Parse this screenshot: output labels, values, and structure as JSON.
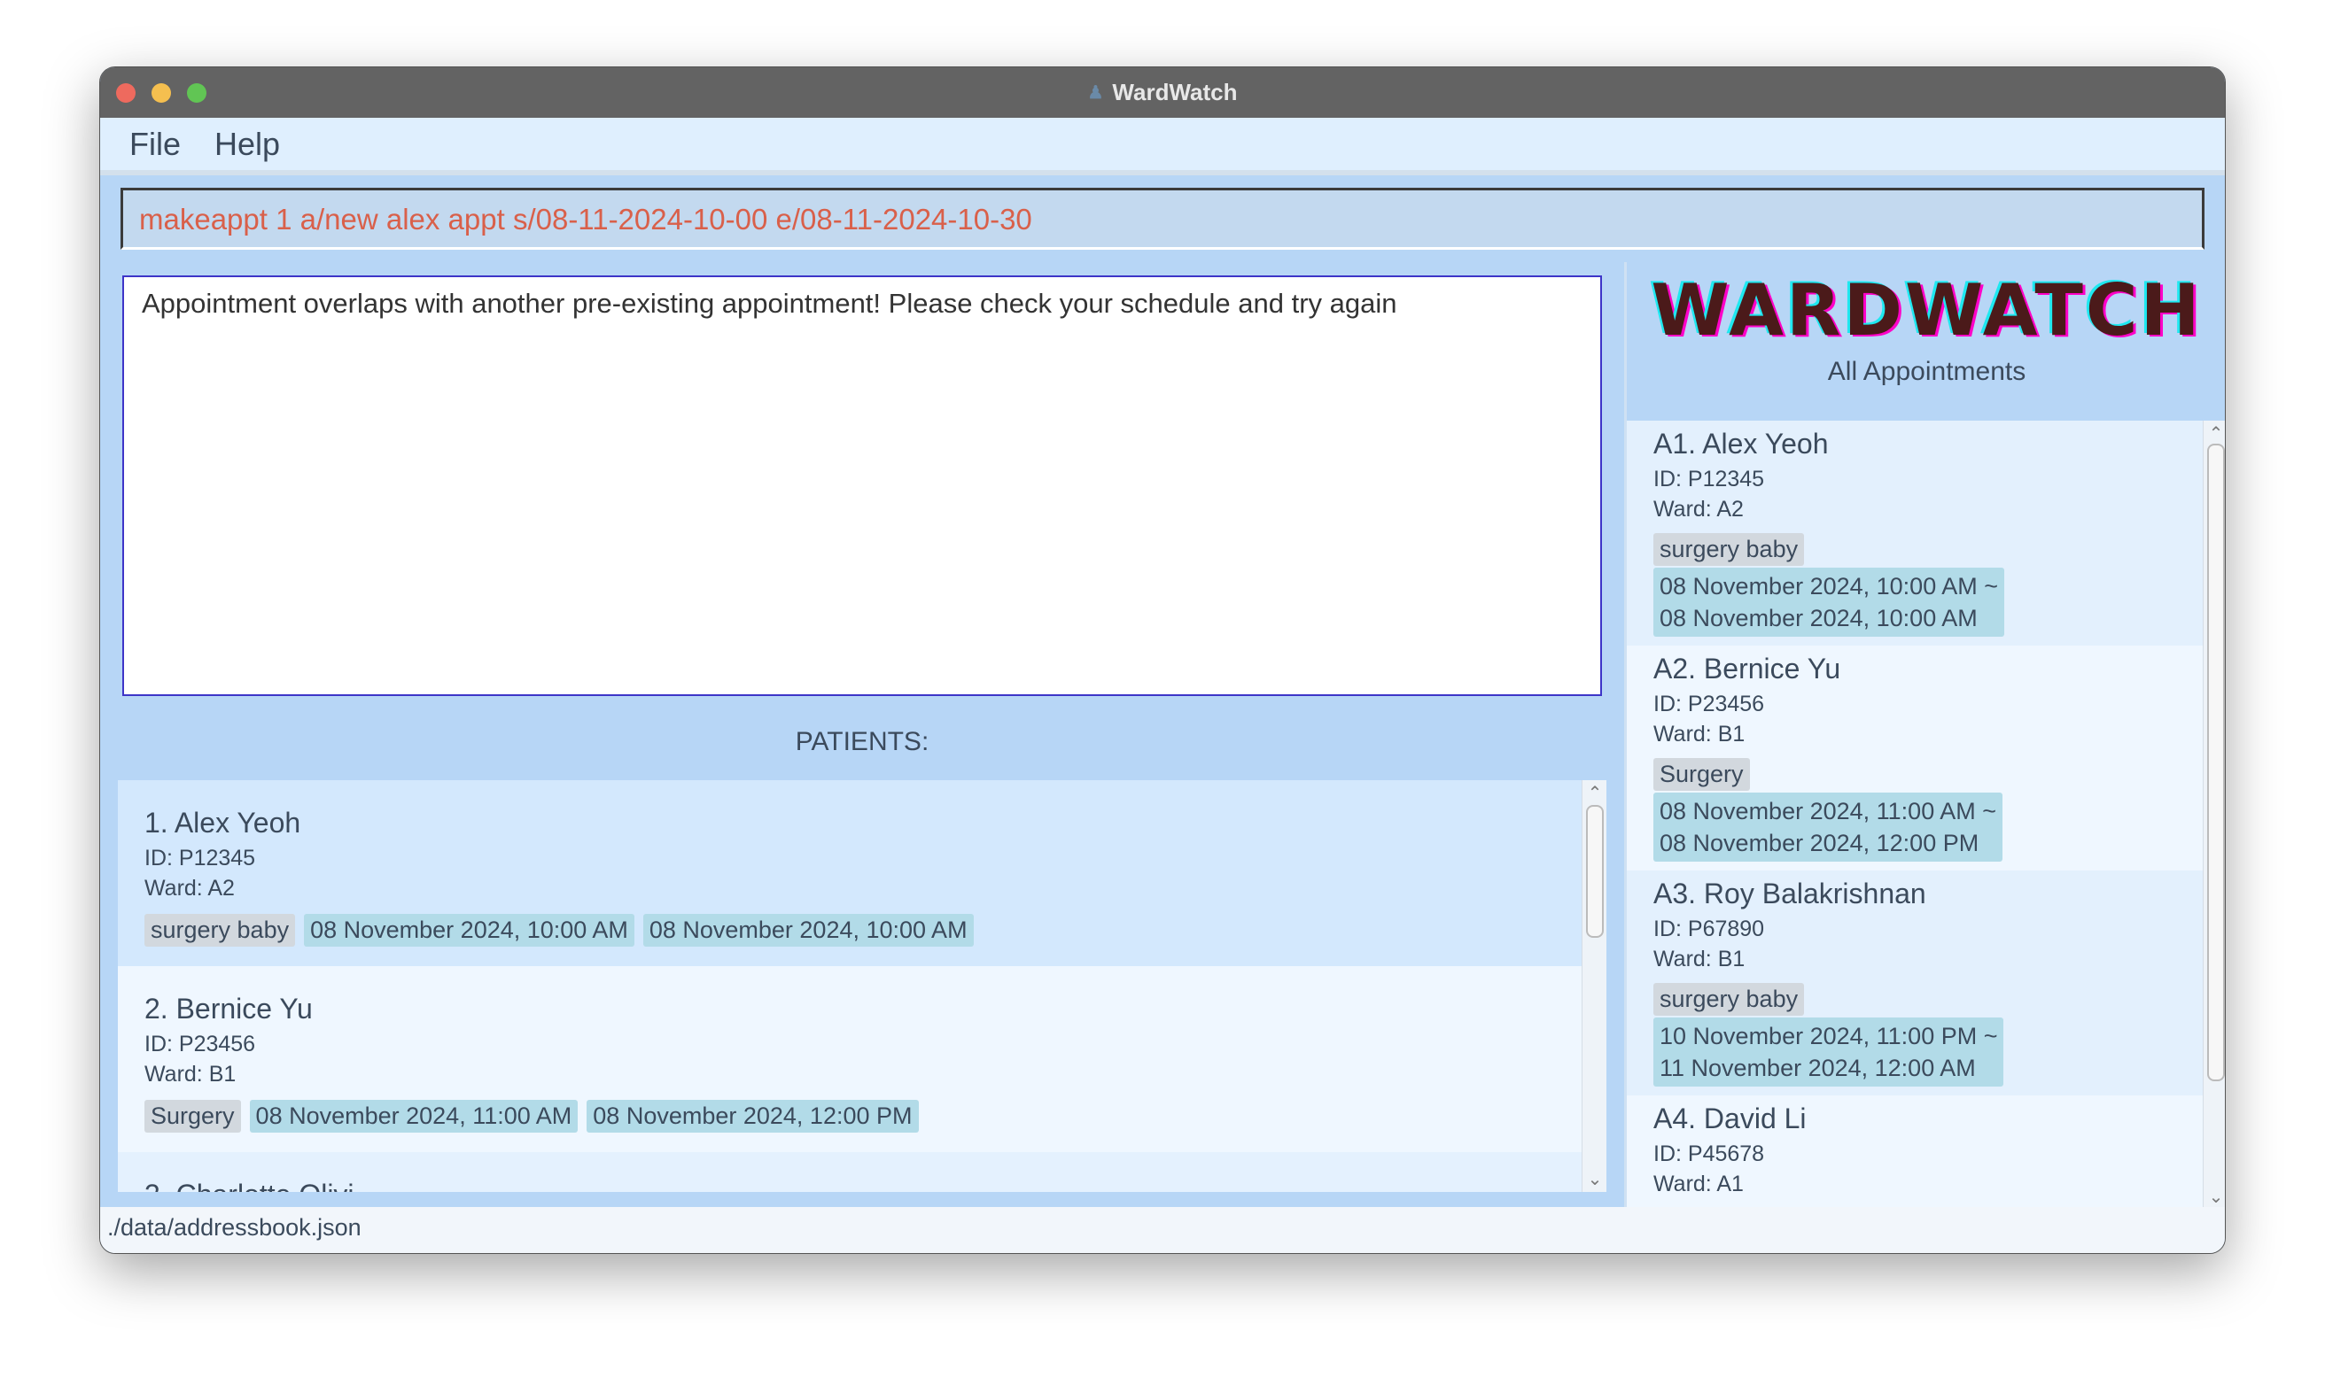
{
  "window": {
    "title": "WardWatch"
  },
  "menu": {
    "file": "File",
    "help": "Help"
  },
  "command": {
    "value": "makeappt 1 a/new alex appt s/08-11-2024-10-00 e/08-11-2024-10-30"
  },
  "result": {
    "text": "Appointment overlaps with another pre-existing appointment! Please check your schedule and try again"
  },
  "patients": {
    "label": "PATIENTS:",
    "items": [
      {
        "name": "1.  Alex Yeoh",
        "id": "ID: P12345",
        "ward": "Ward: A2",
        "tag": "surgery baby",
        "start": "08 November 2024, 10:00 AM",
        "end": "08 November 2024, 10:00 AM"
      },
      {
        "name": "2.  Bernice Yu",
        "id": "ID: P23456",
        "ward": "Ward: B1",
        "tag": "Surgery",
        "start": "08 November 2024, 11:00 AM",
        "end": "08 November 2024, 12:00 PM"
      },
      {
        "name": "3.  Charlotte Olivi"
      }
    ]
  },
  "appointments": {
    "logo": "WARDWATCH",
    "label": "All Appointments",
    "items": [
      {
        "name": "A1.  Alex Yeoh",
        "id": "ID: P12345",
        "ward": "Ward: A2",
        "tag": "surgery baby",
        "start": "08 November 2024, 10:00 AM ~",
        "end": "08 November 2024, 10:00 AM"
      },
      {
        "name": "A2.  Bernice Yu",
        "id": "ID: P23456",
        "ward": "Ward: B1",
        "tag": "Surgery",
        "start": "08 November 2024, 11:00 AM ~",
        "end": "08 November 2024, 12:00 PM"
      },
      {
        "name": "A3.  Roy Balakrishnan",
        "id": "ID: P67890",
        "ward": "Ward: B1",
        "tag": "surgery baby",
        "start": "10 November 2024, 11:00 PM ~",
        "end": "11 November 2024, 12:00 AM"
      },
      {
        "name": "A4.  David Li",
        "id": "ID: P45678",
        "ward": "Ward: A1"
      }
    ]
  },
  "status": {
    "path": "./data/addressbook.json"
  },
  "colors": {
    "accent": "#b7d6f6",
    "command_text": "#d9604a",
    "tag": "#d2d8de",
    "date_tag": "#b2dbe8"
  }
}
